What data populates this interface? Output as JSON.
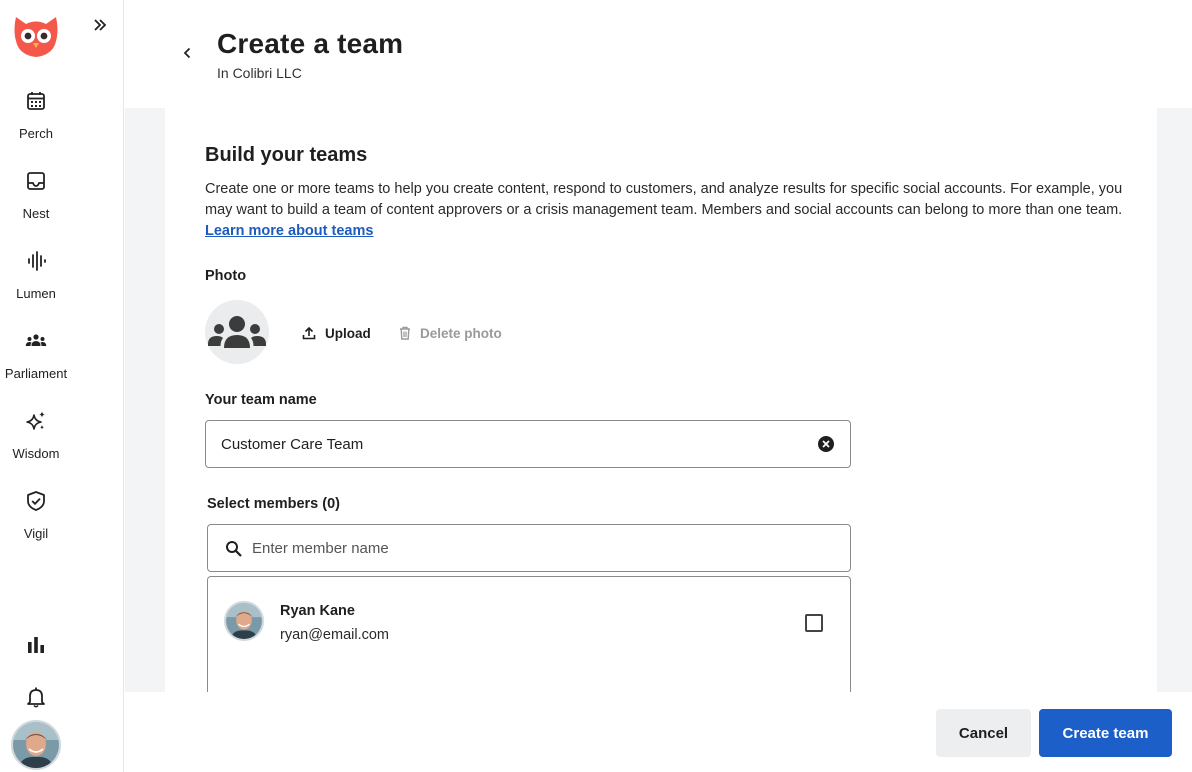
{
  "colors": {
    "brand": "#f4584a",
    "primary": "#1d5fc9",
    "link": "#1d5bbf",
    "sidebar_bg": "#ffffff",
    "content_bg": "#f3f4f5"
  },
  "sidebar": {
    "expand_icon": "double-chevron-right-icon",
    "items": [
      {
        "label": "Perch",
        "icon": "calendar-icon"
      },
      {
        "label": "Nest",
        "icon": "inbox-icon"
      },
      {
        "label": "Lumen",
        "icon": "soundwave-icon"
      },
      {
        "label": "Parliament",
        "icon": "people-icon"
      },
      {
        "label": "Wisdom",
        "icon": "sparkles-icon"
      },
      {
        "label": "Vigil",
        "icon": "shield-check-icon"
      }
    ],
    "bottom_icons": [
      "bar-chart-icon",
      "bell-icon"
    ]
  },
  "header": {
    "title": "Create a team",
    "subtitle": "In Colibri LLC"
  },
  "build": {
    "title": "Build your teams",
    "description": "Create one or more teams to help you create content, respond to customers, and analyze results for specific social accounts. For example, you may want to build a team of content approvers or a crisis management team. Members and social accounts can belong to more than one team. ",
    "link_text": "Learn more about teams"
  },
  "photo": {
    "label": "Photo",
    "upload_label": "Upload",
    "delete_label": "Delete photo"
  },
  "team_name": {
    "label": "Your team name",
    "value": "Customer Care Team"
  },
  "members": {
    "label": "Select members (0)",
    "search_placeholder": "Enter member name",
    "list": [
      {
        "name": "Ryan Kane",
        "email": "ryan@email.com",
        "checked": false
      }
    ]
  },
  "footer": {
    "cancel_label": "Cancel",
    "create_label": "Create team"
  }
}
